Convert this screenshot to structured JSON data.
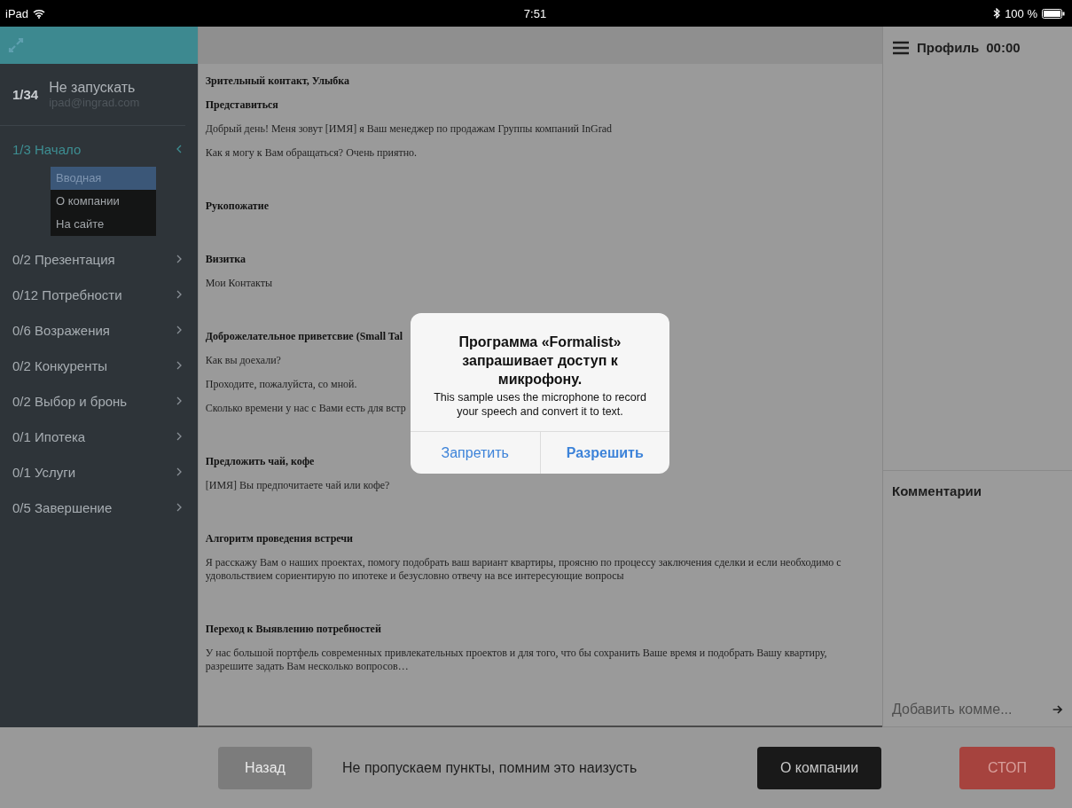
{
  "status_bar": {
    "device": "iPad",
    "time": "7:51",
    "battery": "100 %"
  },
  "sidebar": {
    "counter": "1/34",
    "user_name": "Не запускать",
    "user_email": "ipad@ingrad.com",
    "sections": [
      {
        "label": "1/3 Начало",
        "selected": true,
        "expanded": true,
        "children": [
          {
            "label": "Вводная",
            "selected": true
          },
          {
            "label": "О компании",
            "selected": false
          },
          {
            "label": "На сайте",
            "selected": false
          }
        ]
      },
      {
        "label": "0/2 Презентация",
        "selected": false,
        "expanded": false
      },
      {
        "label": "0/12 Потребности",
        "selected": false,
        "expanded": false
      },
      {
        "label": "0/6 Возражения",
        "selected": false,
        "expanded": false
      },
      {
        "label": "0/2 Конкуренты",
        "selected": false,
        "expanded": false
      },
      {
        "label": "0/2 Выбор и бронь",
        "selected": false,
        "expanded": false
      },
      {
        "label": "0/1 Ипотека",
        "selected": false,
        "expanded": false
      },
      {
        "label": "0/1 Услуги",
        "selected": false,
        "expanded": false
      },
      {
        "label": "0/5 Завершение",
        "selected": false,
        "expanded": false
      }
    ]
  },
  "script": {
    "blocks": [
      {
        "lines": [
          {
            "kind": "heading",
            "text": "Зрительный контакт, Улыбка"
          },
          {
            "kind": "heading",
            "text": "Представиться"
          },
          {
            "kind": "text",
            "text": "Добрый день! Меня зовут [ИМЯ] я Ваш менеджер по продажам Группы компаний InGrad"
          },
          {
            "kind": "text",
            "text": "Как я могу к Вам обращаться? Очень приятно."
          }
        ]
      },
      {
        "lines": [
          {
            "kind": "heading",
            "text": "Рукопожатие"
          }
        ]
      },
      {
        "lines": [
          {
            "kind": "heading",
            "text": "Визитка"
          },
          {
            "kind": "text",
            "text": "Мои Контакты"
          }
        ]
      },
      {
        "lines": [
          {
            "kind": "heading",
            "text": "Доброжелательное приветсвие (Small Tal"
          },
          {
            "kind": "text",
            "text": "Как вы доехали?"
          },
          {
            "kind": "text",
            "text": "Проходите, пожалуйста, со мной."
          },
          {
            "kind": "text",
            "text": "Сколько времени у нас с Вами есть для встр"
          }
        ]
      },
      {
        "lines": [
          {
            "kind": "heading",
            "text": "Предложить чай, кофе"
          },
          {
            "kind": "text",
            "text": "[ИМЯ] Вы предпочитаете чай или кофе?"
          }
        ]
      },
      {
        "lines": [
          {
            "kind": "heading",
            "text": "Алгоритм проведения встречи"
          },
          {
            "kind": "text",
            "text": "Я расскажу Вам о наших проектах, помогу подобрать ваш вариант квартиры, проясню по процессу заключения сделки и если необходимо с удовольствием сориентирую по ипотеке и безусловно отвечу на все интересующие вопросы"
          }
        ]
      },
      {
        "lines": [
          {
            "kind": "heading",
            "text": "Переход к Выявлению потребностей"
          },
          {
            "kind": "text",
            "text": "У нас большой портфель современных привлекательных проектов и для того, что бы сохранить Ваше время и подобрать Вашу квартиру, разрешите задать Вам несколько вопросов…"
          }
        ]
      }
    ]
  },
  "profile": {
    "title": "Профиль",
    "timer": "00:00"
  },
  "comments": {
    "title": "Комментарии",
    "placeholder": "Добавить комме..."
  },
  "bottom_bar": {
    "back_button": {
      "label": "Назад",
      "disabled": true
    },
    "hint": "Не пропускаем пункты, помним это наизусть",
    "next_button": "О компании",
    "stop_button": "СТОП"
  },
  "alert": {
    "title": "Программа «Formalist» запрашивает доступ к микрофону.",
    "message": "This sample uses the microphone to record your speech and convert it to text.",
    "buttons": [
      {
        "label": "Запретить",
        "kind": "cancel"
      },
      {
        "label": "Разрешить",
        "kind": "default"
      }
    ]
  }
}
